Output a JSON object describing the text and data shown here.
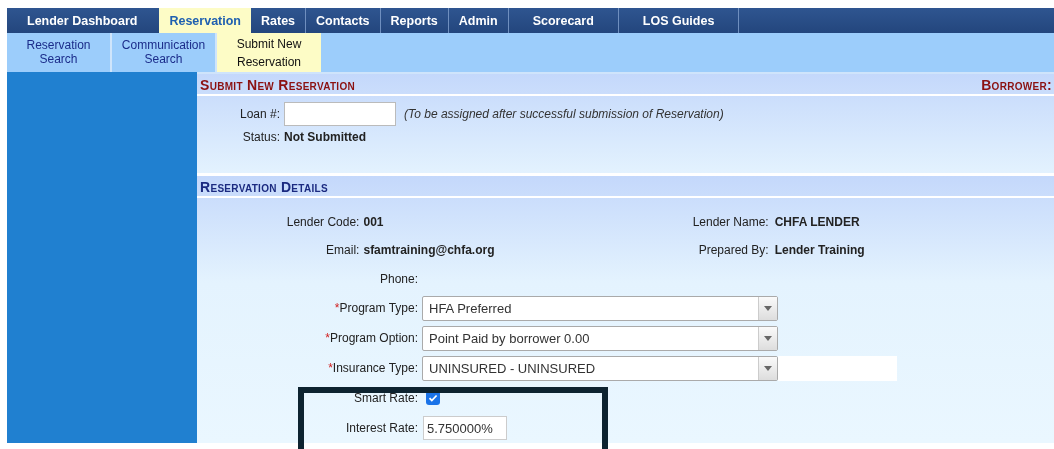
{
  "nav_tabs": [
    {
      "label": "Lender Dashboard",
      "selected": false
    },
    {
      "label": "Reservation",
      "selected": true
    },
    {
      "label": "Rates",
      "selected": false
    },
    {
      "label": "Contacts",
      "selected": false
    },
    {
      "label": "Reports",
      "selected": false
    },
    {
      "label": "Admin",
      "selected": false
    },
    {
      "label": "Scorecard",
      "selected": false
    },
    {
      "label": "LOS Guides",
      "selected": false
    }
  ],
  "sub_tabs": [
    {
      "label": "Reservation Search",
      "selected": false
    },
    {
      "label": "Communication Search",
      "selected": false
    },
    {
      "label": "Submit New Reservation",
      "selected": true
    }
  ],
  "submit_section": {
    "title": "Submit New Reservation",
    "borrower_label": "Borrower:",
    "loan_label": "Loan #:",
    "loan_note": "(To be assigned after successful submission of Reservation)",
    "status_label": "Status:",
    "status_value": "Not Submitted"
  },
  "details_section": {
    "title": "Reservation Details",
    "info_rows": [
      {
        "label": "Lender Code:",
        "value": "001",
        "right_label": "Lender Name:",
        "right_value": "CHFA LENDER"
      },
      {
        "label": "Email:",
        "value": "sfamtraining@chfa.org",
        "right_label": "Prepared By:",
        "right_value": "Lender Training"
      },
      {
        "label": "Phone:"
      }
    ],
    "fields": [
      {
        "kind": "select",
        "marker": "*",
        "label": "Program Type:",
        "value": "HFA Preferred"
      },
      {
        "kind": "select",
        "marker": "*",
        "label": "Program Option:",
        "value": "Point Paid by borrower 0.00"
      },
      {
        "kind": "select",
        "marker": "*",
        "label": "Insurance Type:",
        "value": "UNINSURED - UNINSURED"
      },
      {
        "kind": "checkbox",
        "label": "Smart Rate:",
        "checked": true
      },
      {
        "kind": "text",
        "label": "Interest Rate:",
        "value": "5.750000%"
      }
    ]
  }
}
